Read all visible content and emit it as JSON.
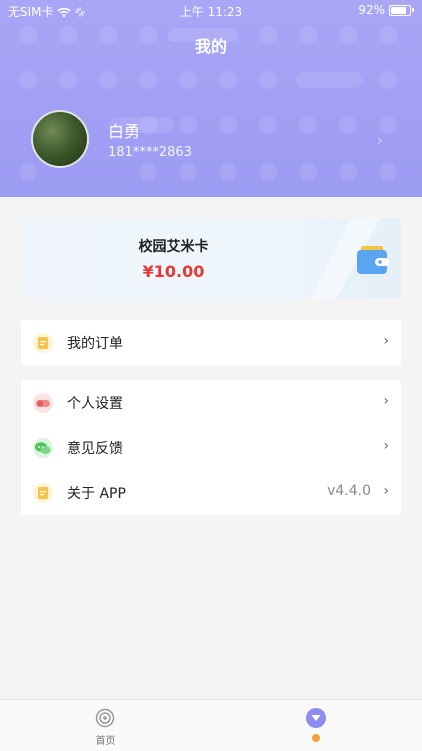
{
  "status_bar": {
    "carrier": "无SIM卡",
    "time": "上午 11:23",
    "battery": "92%"
  },
  "header": {
    "title": "我的"
  },
  "user": {
    "name": "白勇",
    "phone": "181****2863"
  },
  "card": {
    "title": "校园艾米卡",
    "balance": "¥10.00"
  },
  "menu_group_1": [
    {
      "label": "我的订单",
      "icon": "document-icon"
    }
  ],
  "menu_group_2": [
    {
      "label": "个人设置",
      "icon": "settings-icon"
    },
    {
      "label": "意见反馈",
      "icon": "feedback-icon"
    },
    {
      "label": "关于 APP",
      "value": "v4.4.0",
      "icon": "document-icon"
    }
  ],
  "tabbar": {
    "home_label": "首页"
  },
  "colors": {
    "header": "#a9a6f6",
    "accent": "#8e8cf0",
    "balance": "#e53935",
    "badge": "#f2a33a"
  }
}
